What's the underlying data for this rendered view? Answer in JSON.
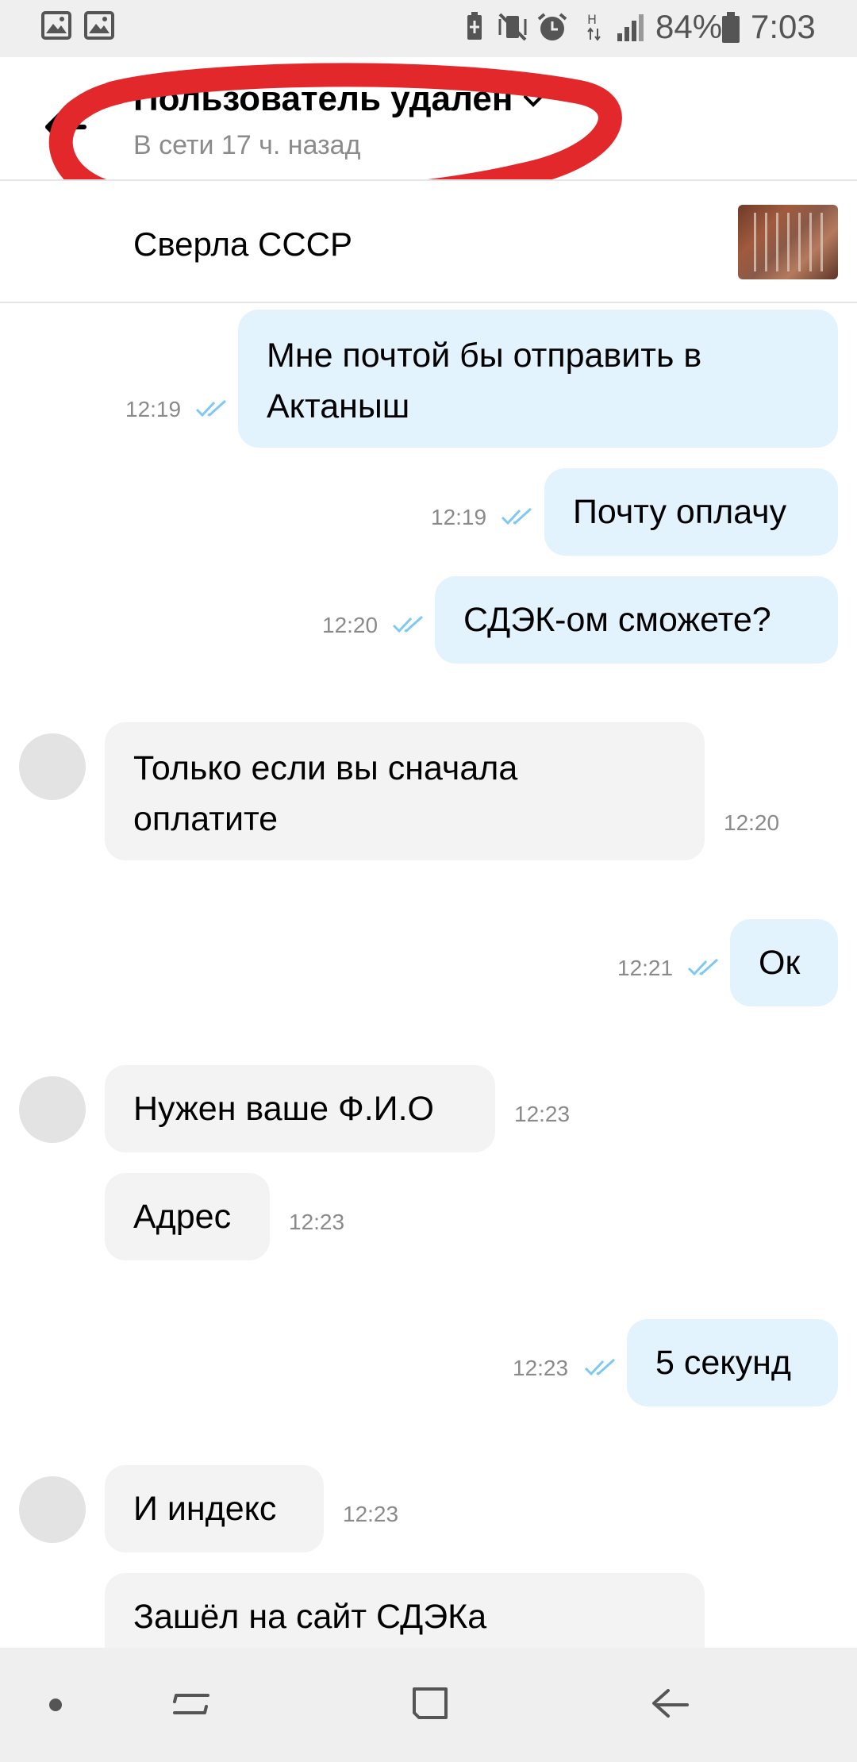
{
  "status_bar": {
    "battery": "84%",
    "time": "7:03",
    "left_icons": [
      "image-icon",
      "image-icon"
    ],
    "right_icons": [
      "battery-saver-icon",
      "mute-icon",
      "alarm-icon",
      "network-h-icon",
      "signal-icon",
      "battery-icon"
    ]
  },
  "header": {
    "title": "Пользователь удален",
    "subtitle": "В сети 17 ч. назад"
  },
  "item": {
    "title": "Сверла СССР"
  },
  "messages": [
    {
      "dir": "out",
      "lines": [
        "Мне почтой бы отправить в",
        "Актаныш"
      ],
      "time": "12:19"
    },
    {
      "dir": "out",
      "lines": [
        "Почту оплачу"
      ],
      "time": "12:19"
    },
    {
      "dir": "out",
      "lines": [
        "СДЭК-ом сможете?"
      ],
      "time": "12:20"
    },
    {
      "dir": "in",
      "lines": [
        "Только если вы сначала",
        "оплатите"
      ],
      "time": "12:20"
    },
    {
      "dir": "out",
      "lines": [
        "Ок"
      ],
      "time": "12:21"
    },
    {
      "dir": "in",
      "lines": [
        "Нужен ваше Ф.И.О"
      ],
      "time": "12:23"
    },
    {
      "dir": "in",
      "lines": [
        "Адрес"
      ],
      "time": "12:23"
    },
    {
      "dir": "out",
      "lines": [
        "5 секунд"
      ],
      "time": "12:23"
    },
    {
      "dir": "in",
      "lines": [
        "И индекс"
      ],
      "time": "12:23"
    },
    {
      "dir": "in",
      "lines": [
        "Зашёл на сайт СДЭКа"
      ],
      "time": ""
    }
  ],
  "colors": {
    "outgoing_bubble": "#e3f3fe",
    "incoming_bubble": "#f3f3f3",
    "read_ticks": "#7ec8f2",
    "annotation": "#e3282b"
  }
}
